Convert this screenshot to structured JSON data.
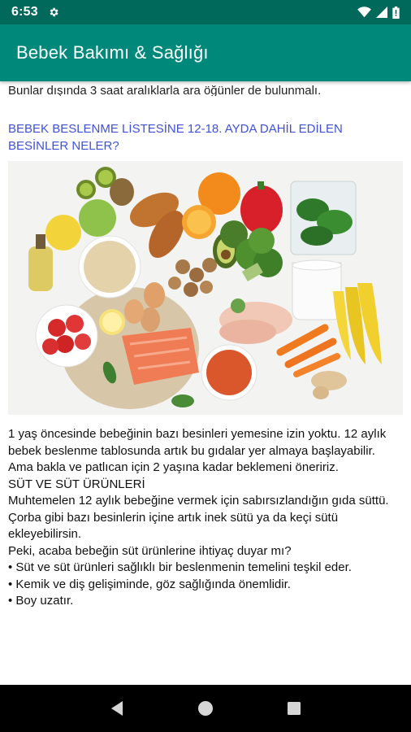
{
  "status_bar": {
    "time": "6:53",
    "icons": [
      "settings-icon",
      "wifi-icon",
      "signal-icon",
      "battery-icon"
    ]
  },
  "app_bar": {
    "title": "Bebek Bakımı & Sağlığı",
    "color": "#00897b",
    "status_color": "#00695c"
  },
  "content": {
    "cut_line": "Bunlar dışında 3 saat aralıklarla ara öğünler de bulunmalı.",
    "heading": "BEBEK BESLENME LİSTESİNE 12-18. AYDA DAHİL EDİLEN BESİNLER NELER?",
    "heading_color": "#3f51d9",
    "image_name": "healthy-foods-image",
    "paragraphs": [
      "1 yaş öncesinde bebeğinin bazı besinleri yemesine izin yoktu. 12 aylık bebek beslenme tablosunda artık bu gıdalar yer almaya başlayabilir. Ama bakla ve patlıcan için 2 yaşına kadar beklemeni öneririz.",
      " SÜT VE SÜT ÜRÜNLERİ",
      " Muhtemelen 12 aylık bebeğine vermek için sabırsızlandığın gıda süttü. Çorba gibi bazı besinlerin içine artık inek sütü ya da keçi sütü ekleyebilirsin.",
      " Peki, acaba bebeğin süt ürünlerine ihtiyaç duyar mı?",
      " • Süt ve süt ürünleri sağlıklı bir beslenmenin temelini teşkil eder.",
      " • Kemik ve diş gelişiminde, göz sağlığında önemlidir.",
      " • Boy uzatır."
    ]
  },
  "nav_bar": {
    "back": "back-icon",
    "home": "home-icon",
    "recents": "recents-icon"
  }
}
